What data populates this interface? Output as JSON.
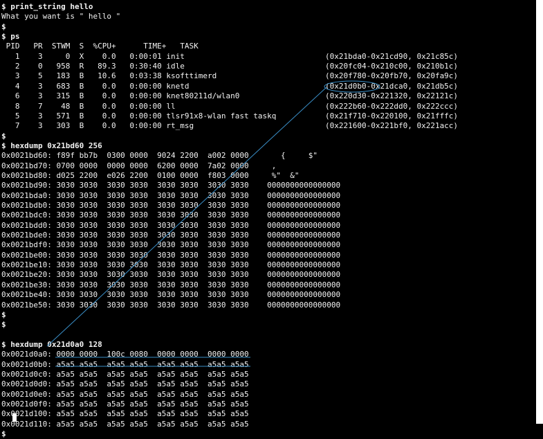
{
  "terminal": {
    "lines": [
      {
        "text": "$ print_string hello",
        "bold": true
      },
      {
        "text": "What you want is \" hello \""
      },
      {
        "text": "$",
        "bold": true
      },
      {
        "text": "$ ps",
        "bold": true
      },
      {
        "text": " PID   PR  STWM  S  %CPU+      TIME+   TASK"
      },
      {
        "text": "   1    3     0  X    0.0   0:00:01 init"
      },
      {
        "text": "   2    0   958  R   89.3   0:30:40 idle"
      },
      {
        "text": "   3    5   183  B   10.6   0:03:38 ksofttimerd"
      },
      {
        "text": "   4    3   683  B    0.0   0:00:00 knetd"
      },
      {
        "text": "   6    3   315  B    0.0   0:00:00 knet80211d/wlan0"
      },
      {
        "text": "   8    7    48  B    0.0   0:00:00 ll"
      },
      {
        "text": "   5    3   571  B    0.0   0:00:00 tlsr91x8-wlan fast taskq"
      },
      {
        "text": "   7    3   303  B    0.0   0:00:00 rt_msg"
      },
      {
        "text": "$",
        "bold": true
      },
      {
        "text": "$ hexdump 0x21bd60 256",
        "bold": true
      },
      {
        "text": "0x0021bd60: f89f bb7b  0300 0000  9024 2200  a002 0000       {     $\""
      },
      {
        "text": "0x0021bd70: 0700 0000  0000 0000  6200 0000  7a02 0000     ,"
      },
      {
        "text": "0x0021bd80: d025 2200  e026 2200  0100 0000  f803 0000     %\"  &\""
      },
      {
        "text": "0x0021bd90: 3030 3030  3030 3030  3030 3030  3030 3030    0000000000000000"
      },
      {
        "text": "0x0021bda0: 3030 3030  3030 3030  3030 3030  3030 3030    0000000000000000"
      },
      {
        "text": "0x0021bdb0: 3030 3030  3030 3030  3030 3030  3030 3030    0000000000000000"
      },
      {
        "text": "0x0021bdc0: 3030 3030  3030 3030  3030 3030  3030 3030    0000000000000000"
      },
      {
        "text": "0x0021bdd0: 3030 3030  3030 3030  3030 3030  3030 3030    0000000000000000"
      },
      {
        "text": "0x0021bde0: 3030 3030  3030 3030  3030 3030  3030 3030    0000000000000000"
      },
      {
        "text": "0x0021bdf0: 3030 3030  3030 3030  3030 3030  3030 3030    0000000000000000"
      },
      {
        "text": "0x0021be00: 3030 3030  3030 3030  3030 3030  3030 3030    0000000000000000"
      },
      {
        "text": "0x0021be10: 3030 3030  3030 3030  3030 3030  3030 3030    0000000000000000"
      },
      {
        "text": "0x0021be20: 3030 3030  3030 3030  3030 3030  3030 3030    0000000000000000"
      },
      {
        "text": "0x0021be30: 3030 3030  3030 3030  3030 3030  3030 3030    0000000000000000"
      },
      {
        "text": "0x0021be40: 3030 3030  3030 3030  3030 3030  3030 3030    0000000000000000"
      },
      {
        "text": "0x0021be50: 3030 3030  3030 3030  3030 3030  3030 3030    0000000000000000"
      },
      {
        "text": "$",
        "bold": true
      },
      {
        "text": "$",
        "bold": true
      },
      {
        "text": ""
      },
      {
        "text": "$ hexdump 0x21d0a0 128",
        "bold": true
      },
      {
        "text": "0x0021d0a0: 0000 0000  100c 0080  0000 0000  0000 0000"
      },
      {
        "text": "0x0021d0b0: a5a5 a5a5  a5a5 a5a5  a5a5 a5a5  a5a5 a5a5"
      },
      {
        "text": "0x0021d0c0: a5a5 a5a5  a5a5 a5a5  a5a5 a5a5  a5a5 a5a5"
      },
      {
        "text": "0x0021d0d0: a5a5 a5a5  a5a5 a5a5  a5a5 a5a5  a5a5 a5a5"
      },
      {
        "text": "0x0021d0e0: a5a5 a5a5  a5a5 a5a5  a5a5 a5a5  a5a5 a5a5"
      },
      {
        "text": "0x0021d0f0: a5a5 a5a5  a5a5 a5a5  a5a5 a5a5  a5a5 a5a5"
      },
      {
        "text": "0x0021d100: a5a5 a5a5  a5a5 a5a5  a5a5 a5a5  a5a5 a5a5"
      },
      {
        "text": "0x0021d110: a5a5 a5a5  a5a5 a5a5  a5a5 a5a5  a5a5 a5a5"
      },
      {
        "text": "$",
        "bold": true
      }
    ],
    "stack_ranges": [
      "(0x21bda0-0x21cd90, 0x21c85c)",
      "(0x20fc04-0x210c00, 0x210b1c)",
      "(0x20f780-0x20fb70, 0x20fa9c)",
      "(0x21d0b0-0x21dca0, 0x21db5c)",
      "(0x220d30-0x221320, 0x22121c)",
      "(0x222b60-0x222dd0, 0x222ccc)",
      "(0x21f710-0x220100, 0x21fffc)",
      "(0x221600-0x221bf0, 0x221acc)"
    ],
    "colors": {
      "background": "#000000",
      "foreground": "#f2f2f2",
      "annotation": "#3a8fc8"
    }
  }
}
